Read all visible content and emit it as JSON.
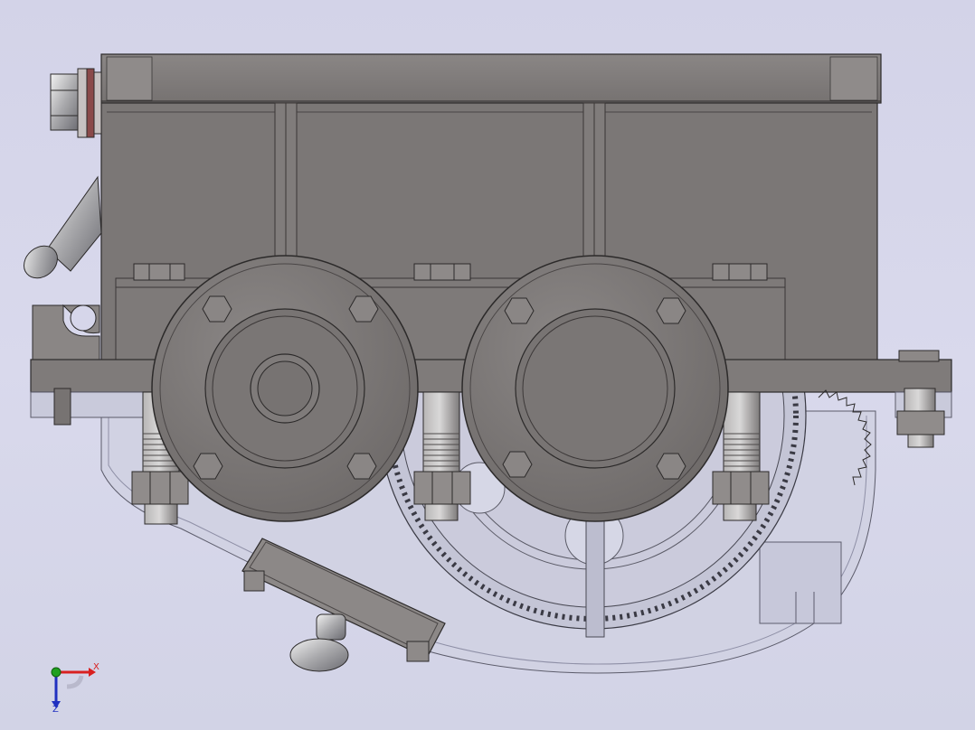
{
  "colors": {
    "background": "#d6d6ea",
    "housing": "#7c7877",
    "housing_dark": "#5f5b5a",
    "housing_light": "#9a9695",
    "edge": "#2c2a2a",
    "transparent_part": "#cfd0e0",
    "axis_x": "#d92020",
    "axis_y": "#20a020",
    "axis_z": "#2030c0"
  },
  "triad": {
    "x_label": "X",
    "z_label": "Z",
    "x_icon": "x-axis-arrow-icon",
    "z_icon": "z-axis-arrow-icon",
    "origin_icon": "origin-sphere-icon"
  }
}
